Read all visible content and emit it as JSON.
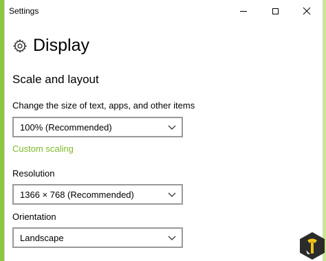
{
  "window": {
    "title": "Settings"
  },
  "page": {
    "title": "Display"
  },
  "section": {
    "title": "Scale and layout"
  },
  "scale": {
    "label": "Change the size of text, apps, and other items",
    "value": "100% (Recommended)"
  },
  "custom_scaling": {
    "label": "Custom scaling"
  },
  "resolution": {
    "label": "Resolution",
    "value": "1366 × 768 (Recommended)"
  },
  "orientation": {
    "label": "Orientation",
    "value": "Landscape"
  },
  "icons": {
    "gear": "gear-icon",
    "chevron": "chevron-down-icon",
    "minimize": "minimize-icon",
    "maximize": "maximize-icon",
    "close": "close-icon",
    "logo": "watermark-logo-icon"
  },
  "colors": {
    "accent": "#7cb92a",
    "background_green": "#8cc63f"
  }
}
